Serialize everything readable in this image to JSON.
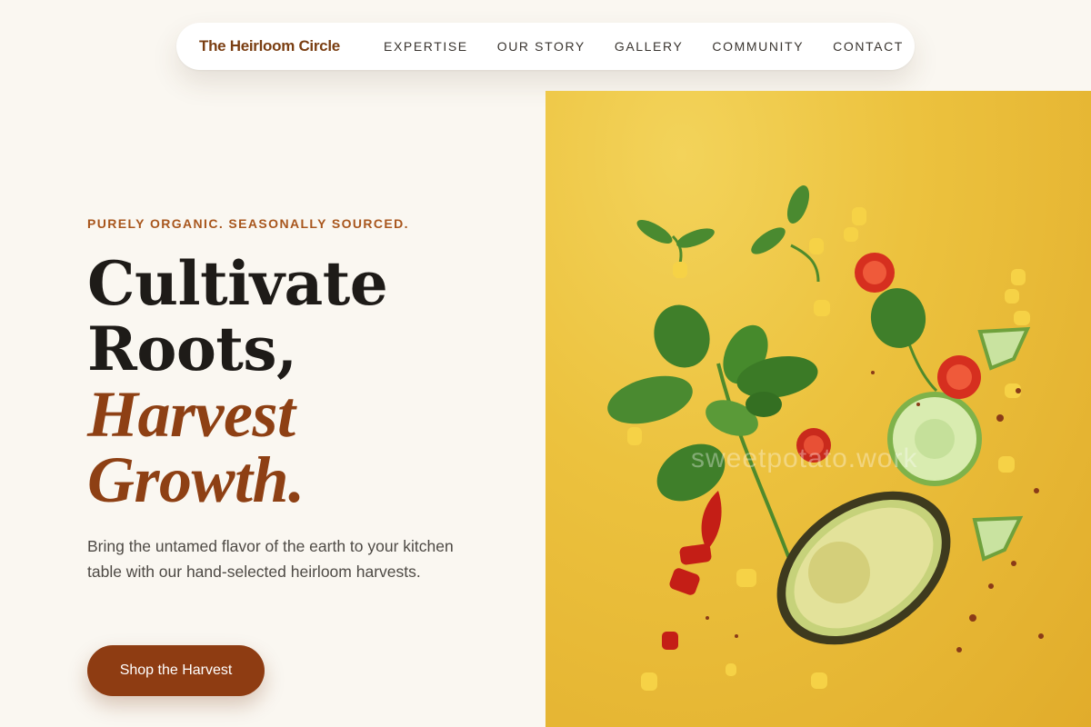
{
  "nav": {
    "brand": "The Heirloom Circle",
    "links": [
      "EXPERTISE",
      "OUR STORY",
      "GALLERY",
      "COMMUNITY",
      "CONTACT"
    ]
  },
  "hero": {
    "eyebrow": "PURELY ORGANIC. SEASONALLY SOURCED.",
    "headline_line1": "Cultivate",
    "headline_line2": "Roots,",
    "headline_accent_line1": "Harvest",
    "headline_accent_line2": "Growth.",
    "subtext": "Bring the untamed flavor of the earth to your kitchen table with our hand-selected heirloom harvests.",
    "cta_label": "Shop the Harvest",
    "image_watermark": "sweetpotato.work"
  },
  "colors": {
    "background": "#faf7f1",
    "accent": "#8e4014",
    "eyebrow": "#a8561d",
    "cta": "#8e3c12",
    "image_bg": "#ecc23e"
  }
}
